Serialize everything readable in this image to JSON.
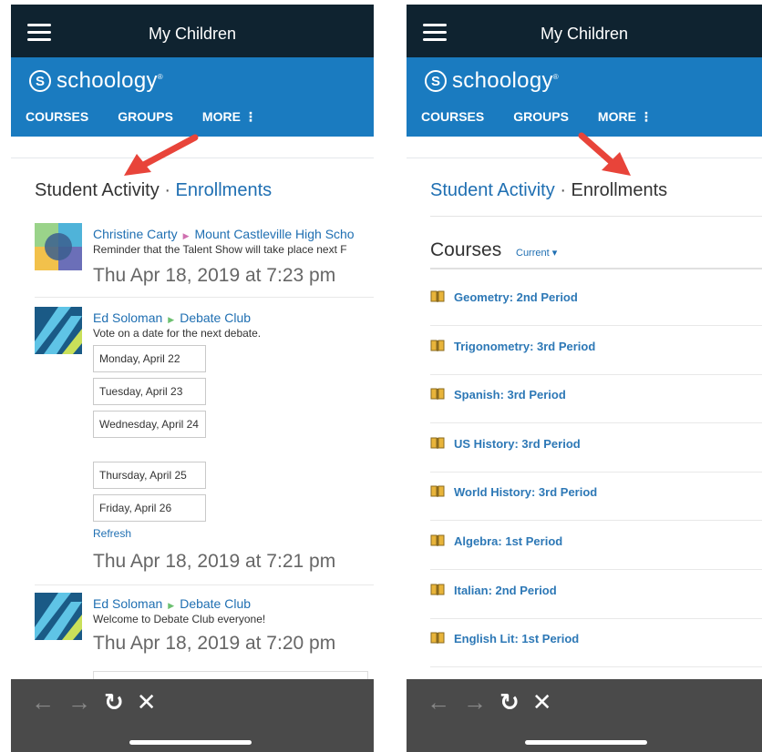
{
  "left_screen": {
    "header": {
      "title": "My Children"
    },
    "brand": {
      "name": "schoology",
      "mark": "S"
    },
    "nav": [
      "COURSES",
      "GROUPS",
      "MORE"
    ],
    "tabs": {
      "active": "Student Activity",
      "separator": "·",
      "other": "Enrollments"
    },
    "feed": [
      {
        "author": "Christine Carty",
        "target": "Mount Castleville High Scho",
        "text": "Reminder that the Talent Show will take place next F",
        "time": "Thu Apr 18, 2019 at 7:23 pm"
      },
      {
        "author": "Ed Soloman",
        "target": "Debate Club",
        "text": "Vote on a date for the next debate.",
        "poll_options": [
          "Monday, April 22",
          "Tuesday, April 23",
          "Wednesday, April 24",
          "Thursday, April 25",
          "Friday, April 26"
        ],
        "refresh": "Refresh",
        "time": "Thu Apr 18, 2019 at 7:21 pm"
      },
      {
        "author": "Ed Soloman",
        "target": "Debate Club",
        "text": "Welcome to Debate Club everyone!",
        "time": "Thu Apr 18, 2019 at 7:20 pm"
      }
    ]
  },
  "right_screen": {
    "header": {
      "title": "My Children"
    },
    "brand": {
      "name": "schoology",
      "mark": "S"
    },
    "nav": [
      "COURSES",
      "GROUPS",
      "MORE"
    ],
    "tabs": {
      "other": "Student Activity",
      "separator": "·",
      "active": "Enrollments"
    },
    "courses": {
      "title": "Courses",
      "filter": "Current",
      "items": [
        "Geometry: 2nd Period",
        "Trigonometry: 3rd Period",
        "Spanish: 3rd Period",
        "US History: 3rd Period",
        "World History: 3rd Period",
        "Algebra: 1st Period",
        "Italian: 2nd Period",
        "English Lit: 1st Period"
      ]
    }
  },
  "browser_bar": {
    "icons": [
      "back-arrow-icon",
      "forward-arrow-icon",
      "reload-icon",
      "close-icon"
    ]
  },
  "colors": {
    "header_bg": "#0f2330",
    "brand_bg": "#1a7bc0",
    "link": "#1f6fb2",
    "arrow": "#e8443a",
    "bottom_bar": "#4a4a4a"
  }
}
